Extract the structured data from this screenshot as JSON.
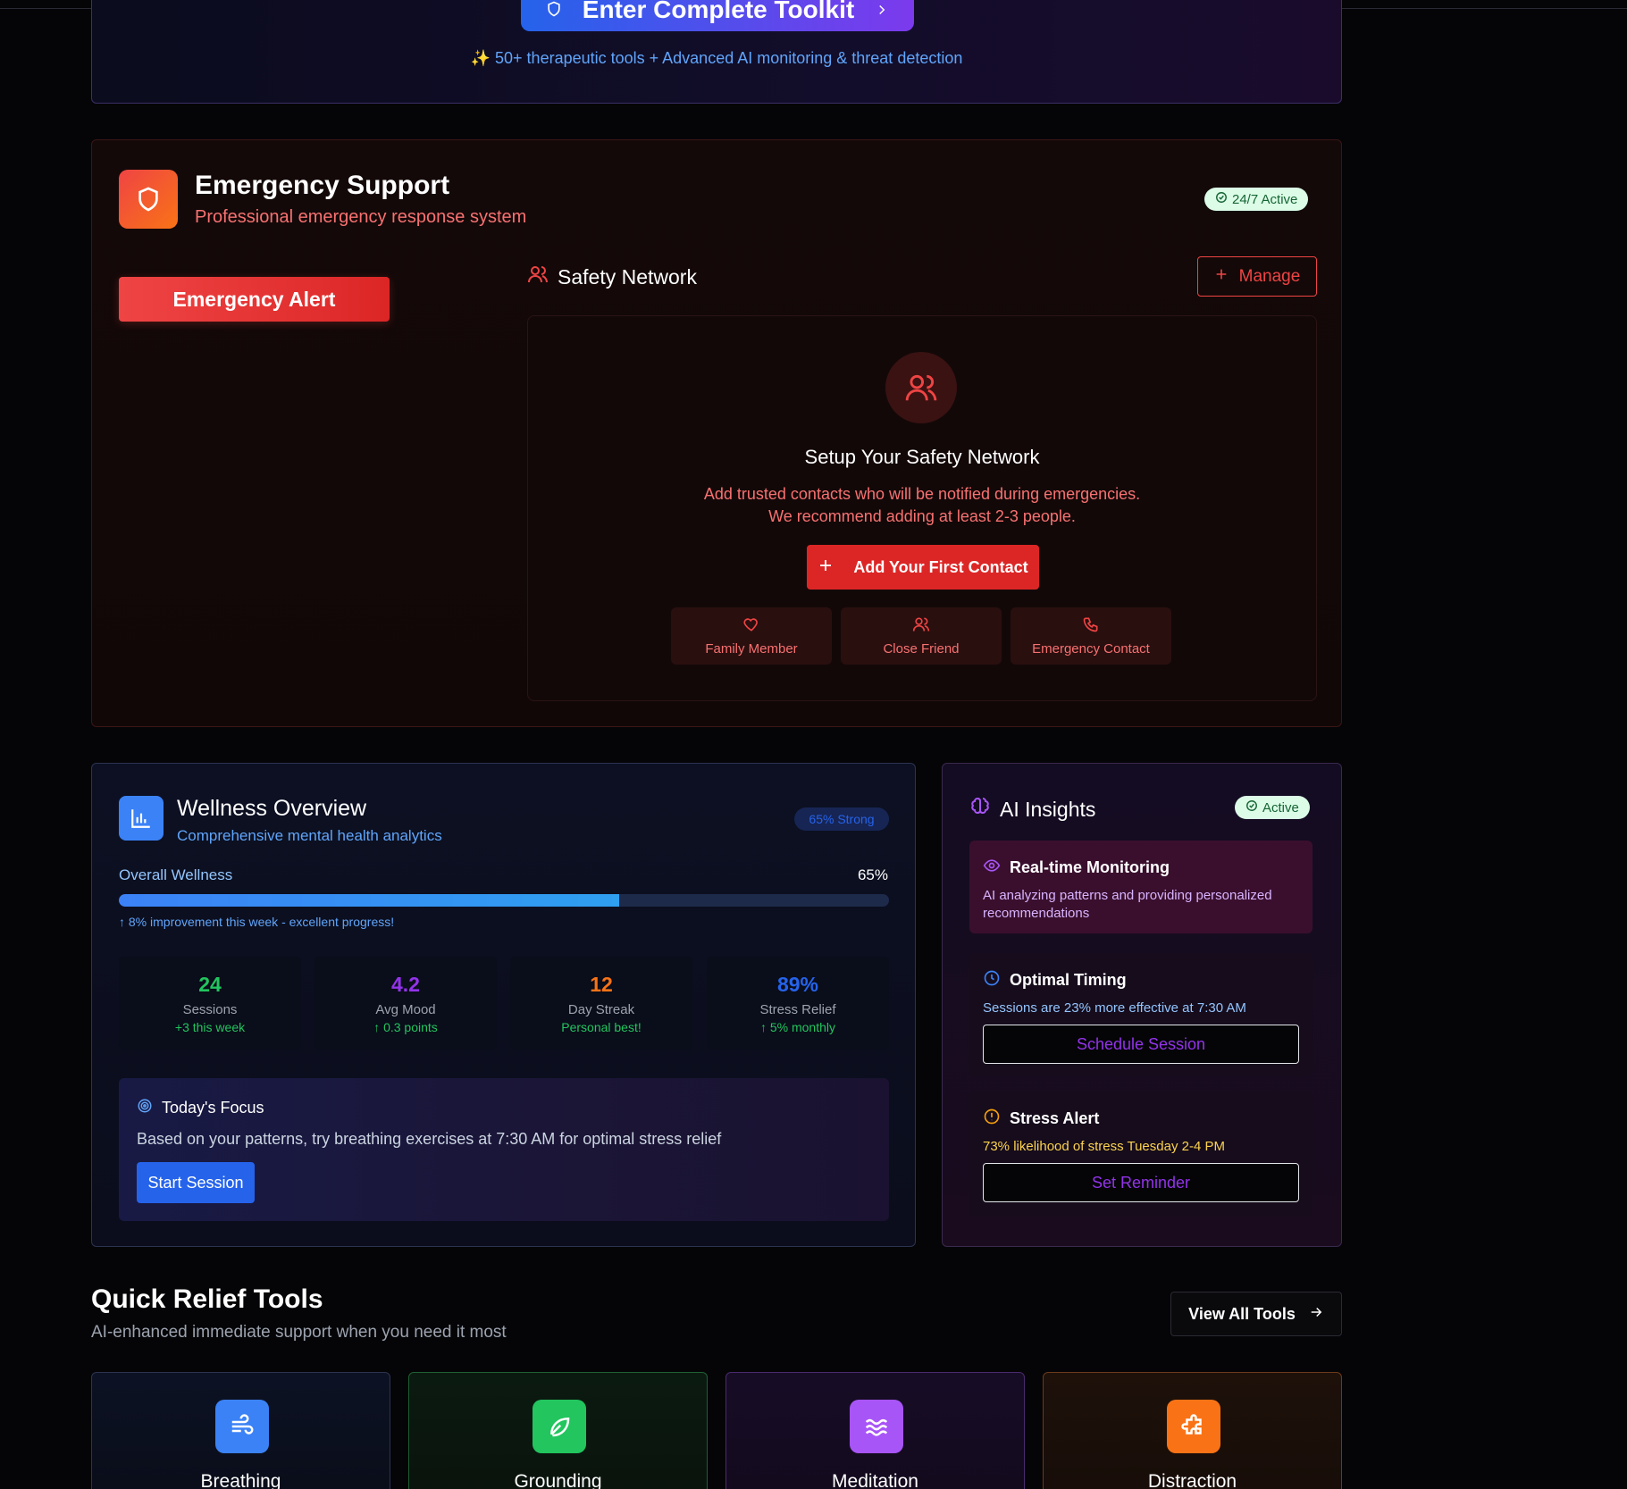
{
  "toolkit": {
    "button_label": "Enter Complete Toolkit",
    "note": "✨ 50+ therapeutic tools + Advanced AI monitoring & threat detection"
  },
  "emergency": {
    "title": "Emergency Support",
    "subtitle": "Professional emergency response system",
    "status_badge": "24/7 Active",
    "alert_button": "Emergency Alert",
    "safety_network": {
      "title": "Safety Network",
      "manage_button": "Manage",
      "setup_title": "Setup Your Safety Network",
      "setup_desc_line1": "Add trusted contacts who will be notified during emergencies.",
      "setup_desc_line2": "We recommend adding at least 2-3 people.",
      "add_button": "Add Your First Contact",
      "contact_types": [
        {
          "label": "Family Member",
          "icon": "heart-icon"
        },
        {
          "label": "Close Friend",
          "icon": "users-icon"
        },
        {
          "label": "Emergency Contact",
          "icon": "phone-icon"
        }
      ]
    }
  },
  "wellness": {
    "title": "Wellness Overview",
    "subtitle": "Comprehensive mental health analytics",
    "badge": "65% Strong",
    "overall_label": "Overall Wellness",
    "overall_value": "65%",
    "overall_progress": 0.65,
    "improvement": "↑ 8% improvement this week - excellent progress!",
    "stats": [
      {
        "value": "24",
        "label": "Sessions",
        "change": "+3 this week",
        "color": "#22c55e",
        "change_color": "#22c55e"
      },
      {
        "value": "4.2",
        "label": "Avg Mood",
        "change": "↑ 0.3 points",
        "color": "#9333ea",
        "change_color": "#22c55e"
      },
      {
        "value": "12",
        "label": "Day Streak",
        "change": "Personal best!",
        "color": "#f97316",
        "change_color": "#22c55e"
      },
      {
        "value": "89%",
        "label": "Stress Relief",
        "change": "↑ 5% monthly",
        "color": "#2563eb",
        "change_color": "#22c55e"
      }
    ],
    "focus": {
      "title": "Today's Focus",
      "desc": "Based on your patterns, try breathing exercises at 7:30 AM for optimal stress relief",
      "button": "Start Session"
    }
  },
  "ai": {
    "title": "AI Insights",
    "badge": "Active",
    "insights": [
      {
        "title": "Real-time Monitoring",
        "desc": "AI analyzing patterns and providing personalized recommendations",
        "icon": "eye-icon"
      },
      {
        "title": "Optimal Timing",
        "desc": "Sessions are 23% more effective at 7:30 AM",
        "button": "Schedule Session",
        "icon": "clock-icon"
      },
      {
        "title": "Stress Alert",
        "desc": "73% likelihood of stress Tuesday 2-4 PM",
        "button": "Set Reminder",
        "icon": "alert-circle-icon"
      }
    ]
  },
  "quick_relief": {
    "title": "Quick Relief Tools",
    "subtitle": "AI-enhanced immediate support when you need it most",
    "view_all": "View All Tools",
    "tools": [
      {
        "name": "Breathing",
        "icon": "wind-icon",
        "color": "#3b82f6"
      },
      {
        "name": "Grounding",
        "icon": "leaf-icon",
        "color": "#22c55e"
      },
      {
        "name": "Meditation",
        "icon": "waves-icon",
        "color": "#a855f7"
      },
      {
        "name": "Distraction",
        "icon": "puzzle-icon",
        "color": "#f97316"
      }
    ]
  }
}
